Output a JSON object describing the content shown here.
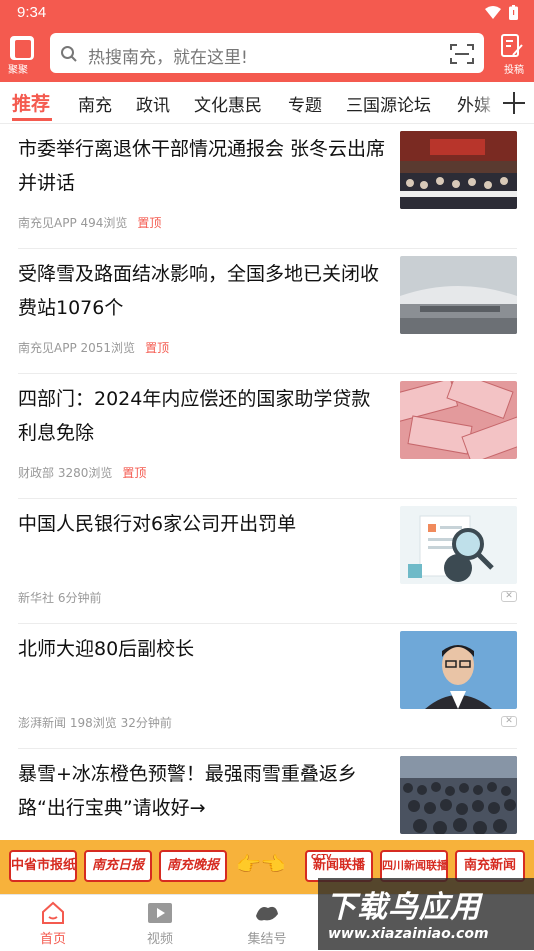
{
  "status_bar": {
    "time": "9:34"
  },
  "header": {
    "logo_label": "聚聚",
    "search_placeholder": "热搜南充，就在这里!",
    "post_label": "投稿"
  },
  "tabs": [
    "推荐",
    "南充",
    "政讯",
    "文化惠民",
    "专题",
    "三国源论坛",
    "外媒"
  ],
  "articles": [
    {
      "title": "市委举行离退休干部情况通报会 张冬云出席并讲话",
      "source": "南充见APP",
      "views": "494浏览",
      "pin": "置顶",
      "image": "meeting-photo"
    },
    {
      "title": "受降雪及路面结冰影响，全国多地已关闭收费站1076个",
      "source": "南充见APP",
      "views": "2051浏览",
      "pin": "置顶",
      "image": "toll-station-photo"
    },
    {
      "title": "四部门：2024年内应偿还的国家助学贷款利息免除",
      "source": "财政部",
      "views": "3280浏览",
      "pin": "置顶",
      "image": "banknotes-photo"
    },
    {
      "title": "中国人民银行对6家公司开出罚单",
      "source": "新华社",
      "views": "6分钟前",
      "pin": "",
      "image": "magnifier-illustration"
    },
    {
      "title": "北师大迎80后副校长",
      "source": "澎湃新闻",
      "views": "198浏览 32分钟前",
      "pin": "",
      "image": "portrait-photo"
    },
    {
      "title": "暴雪+冰冻橙色预警！最强雨雪重叠返乡路“出行宝典”请收好→",
      "source": "",
      "views": "",
      "pin": "",
      "image": "station-crowd-photo"
    }
  ],
  "banner": {
    "items": [
      "中省市报纸",
      "南充日报",
      "南充晚报",
      "新闻联播",
      "四川新闻联播",
      "南充新闻"
    ],
    "badge_cctv": "CCTV"
  },
  "bottom_tabs": [
    "首页",
    "视频",
    "集结号"
  ],
  "watermark": {
    "text": "下载鸟应用",
    "url": "www.xiazainiao.com"
  },
  "colors": {
    "brand": "#f45a4f",
    "banner": "#f7b23b"
  }
}
